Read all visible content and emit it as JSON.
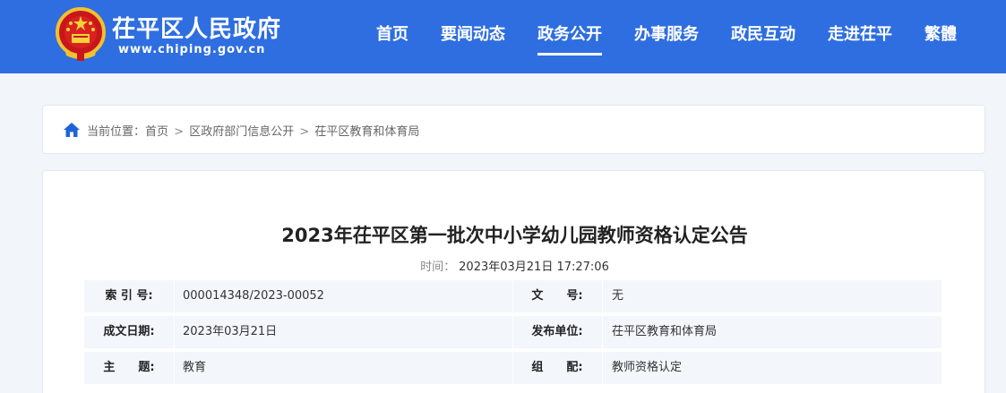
{
  "header": {
    "site_title": "茌平区人民政府",
    "site_url": "www.chiping.gov.cn",
    "emblem_icon": "national-emblem-icon",
    "nav": [
      {
        "label": "首页",
        "active": false
      },
      {
        "label": "要闻动态",
        "active": false
      },
      {
        "label": "政务公开",
        "active": true
      },
      {
        "label": "办事服务",
        "active": false
      },
      {
        "label": "政民互动",
        "active": false
      },
      {
        "label": "走进茌平",
        "active": false
      },
      {
        "label": "繁體",
        "active": false
      }
    ]
  },
  "breadcrumb": {
    "prefix": "当前位置：",
    "items": [
      "首页",
      "区政府部门信息公开",
      "茌平区教育和体育局"
    ],
    "separator": ">"
  },
  "article": {
    "title": "2023年茌平区第一批次中小学幼儿园教师资格认定公告",
    "time_label": "时间：",
    "time_value": "2023年03月21日 17:27:06",
    "meta": [
      {
        "label1": "索 引 号:",
        "value1": "000014348/2023-00052",
        "label2": "文　　号:",
        "value2": "无"
      },
      {
        "label1": "成文日期:",
        "value1": "2023年03月21日",
        "label2": "发布单位:",
        "value2": "茌平区教育和体育局"
      },
      {
        "label1": "主　　题:",
        "value1": "教育",
        "label2": "组　　配:",
        "value2": "教师资格认定"
      }
    ]
  },
  "colors": {
    "header_bg": "#2e6ee0",
    "page_bg": "#f2f5f9",
    "meta_row_bg": "#f3f6fb",
    "home_icon": "#1f63d8"
  }
}
